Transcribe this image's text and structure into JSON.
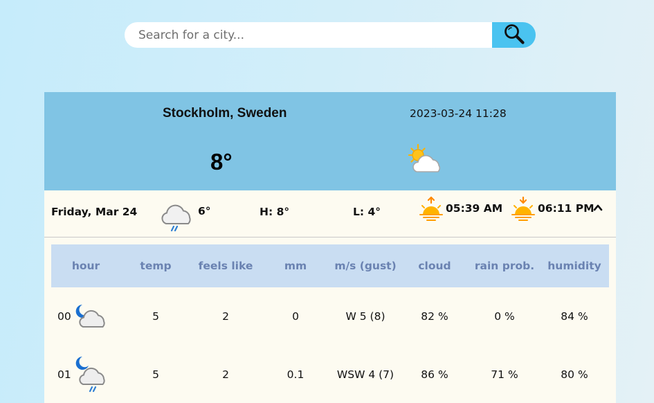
{
  "search": {
    "placeholder": "Search for a city...",
    "value": ""
  },
  "current": {
    "location": "Stockholm, Sweden",
    "datetime": "2023-03-24 11:28",
    "temperature": "8°",
    "condition_icon": "partly-cloudy-icon"
  },
  "day": {
    "label": "Friday, Mar 24",
    "icon": "cloud-rain-icon",
    "temp": "6°",
    "high": "H: 8°",
    "low": "L: 4°",
    "sunrise": "05:39 AM",
    "sunset": "06:11 PM",
    "collapse_icon": "chevron-up-icon"
  },
  "table": {
    "headers": [
      "hour",
      "temp",
      "feels like",
      "mm",
      "m/s (gust)",
      "cloud",
      "rain prob.",
      "humidity"
    ],
    "rows": [
      {
        "hour": "00",
        "icon": "moon-cloud-icon",
        "temp": "5",
        "feels_like": "2",
        "mm": "0",
        "wind": "W 5 (8)",
        "cloud": "82 %",
        "rain_prob": "0 %",
        "humidity": "84 %"
      },
      {
        "hour": "01",
        "icon": "moon-cloud-rain-icon",
        "temp": "5",
        "feels_like": "2",
        "mm": "0.1",
        "wind": "WSW 4 (7)",
        "cloud": "86 %",
        "rain_prob": "71 %",
        "humidity": "80 %"
      }
    ]
  },
  "colors": {
    "page_background": "#c6ecfb",
    "search_button": "#4ac3f0",
    "header_band": "#80c4e4",
    "card_background": "#fdfbf1",
    "table_header_background": "#c9ddf2",
    "table_header_text": "#6a82b1",
    "sun": "#ffa800",
    "moon": "#1a6fd0"
  }
}
